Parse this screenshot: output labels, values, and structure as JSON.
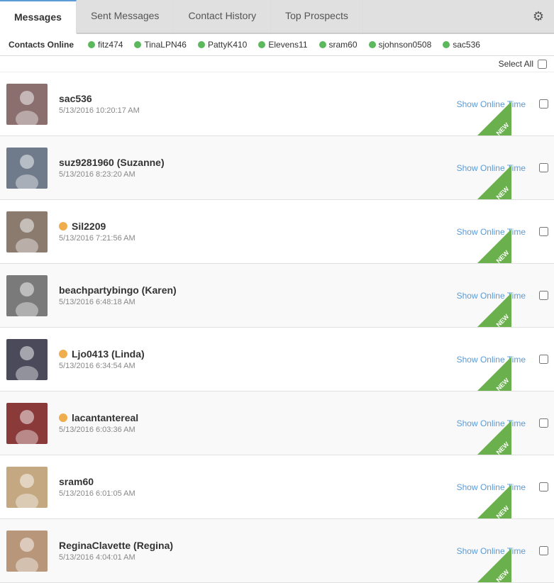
{
  "tabs": [
    {
      "id": "messages",
      "label": "Messages",
      "active": true
    },
    {
      "id": "sent",
      "label": "Sent Messages",
      "active": false
    },
    {
      "id": "contact-history",
      "label": "Contact History",
      "active": false
    },
    {
      "id": "top-prospects",
      "label": "Top Prospects",
      "active": false
    }
  ],
  "gear_label": "⚙",
  "contacts_online_label": "Contacts Online",
  "online_users": [
    {
      "name": "fitz474"
    },
    {
      "name": "TinaLPN46"
    },
    {
      "name": "PattyK410"
    },
    {
      "name": "Elevens11"
    },
    {
      "name": "sram60"
    },
    {
      "name": "sjohnson0508"
    },
    {
      "name": "sac536"
    }
  ],
  "select_all_label": "Select All",
  "messages": [
    {
      "username": "sac536",
      "timestamp": "5/13/2016 10:20:17 AM",
      "show_online_label": "Show Online Time",
      "is_new": true,
      "online": false,
      "avatar_color": "#8B6F6F"
    },
    {
      "username": "suz9281960 (Suzanne)",
      "timestamp": "5/13/2016 8:23:20 AM",
      "show_online_label": "Show Online Time",
      "is_new": true,
      "online": false,
      "avatar_color": "#6F7A8B"
    },
    {
      "username": "Sil2209",
      "timestamp": "5/13/2016 7:21:56 AM",
      "show_online_label": "Show Online Time",
      "is_new": true,
      "online": true,
      "avatar_color": "#8B7B6F"
    },
    {
      "username": "beachpartybingo (Karen)",
      "timestamp": "5/13/2016 6:48:18 AM",
      "show_online_label": "Show Online Time",
      "is_new": true,
      "online": false,
      "avatar_color": "#7A7A7A"
    },
    {
      "username": "Ljo0413 (Linda)",
      "timestamp": "5/13/2016 6:34:54 AM",
      "show_online_label": "Show Online Time",
      "is_new": true,
      "online": true,
      "avatar_color": "#4A4A5A"
    },
    {
      "username": "lacantantereal",
      "timestamp": "5/13/2016 6:03:36 AM",
      "show_online_label": "Show Online Time",
      "is_new": true,
      "online": true,
      "avatar_color": "#8B3A3A"
    },
    {
      "username": "sram60",
      "timestamp": "5/13/2016 6:01:05 AM",
      "show_online_label": "Show Online Time",
      "is_new": true,
      "online": false,
      "avatar_color": "#C4A882"
    },
    {
      "username": "ReginaClavette (Regina)",
      "timestamp": "5/13/2016 4:04:01 AM",
      "show_online_label": "Show Online Time",
      "is_new": true,
      "online": false,
      "avatar_color": "#B8967A"
    }
  ]
}
